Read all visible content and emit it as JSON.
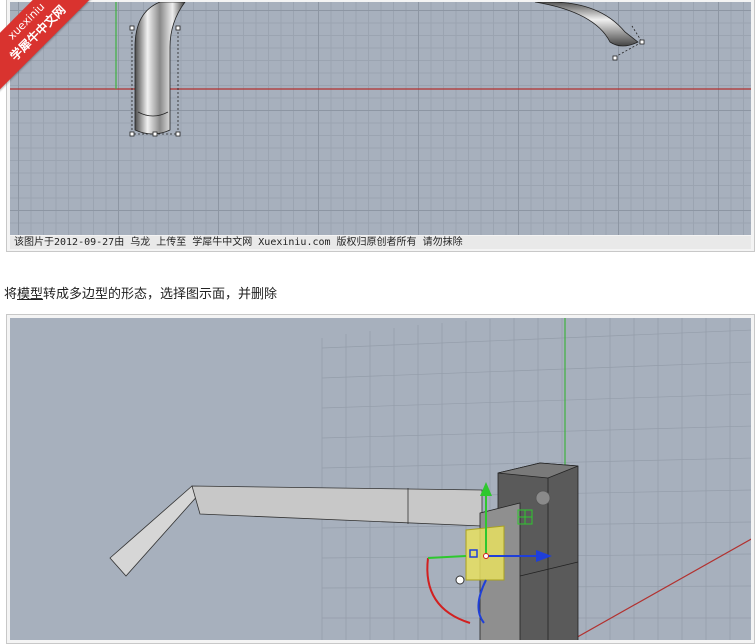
{
  "watermark": {
    "line1": "xuexiniu",
    "line2": "学犀牛中文网"
  },
  "panel1": {
    "caption": "该图片于2012-09-27由 乌龙 上传至 学犀牛中文网 Xuexiniu.com 版权归原创者所有 请勿抹除"
  },
  "instruction": {
    "prefix": "将",
    "link": "模型",
    "suffix": "转成多边型的形态，选择图示面，并删除"
  },
  "colors": {
    "viewport_bg": "#a7b0bd",
    "grid_major": "#8d96a3",
    "x_axis": "#b2312f",
    "y_axis": "#3fb23f",
    "gumball_x": "#1f3fd8",
    "gumball_y": "#2ec82e",
    "gumball_z": "#d22020",
    "selected_face": "#e8e060",
    "watermark_bg": "#d9332f"
  }
}
